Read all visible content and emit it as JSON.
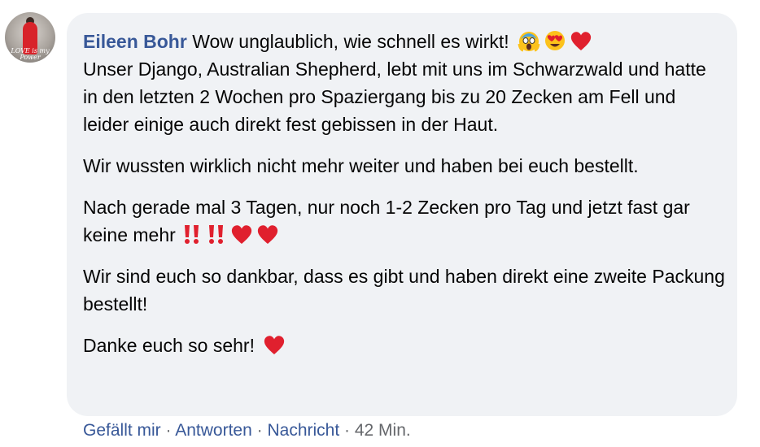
{
  "comment": {
    "author": "Eileen Bohr",
    "avatar_caption": "LOVE is my Power",
    "lines": {
      "l1_text": "Wow unglaublich, wie schnell es wirkt!",
      "p1": "Unser Django, Australian Shepherd, lebt mit uns im Schwarzwald und hatte in den letzten 2 Wochen pro Spaziergang bis zu 20 Zecken am Fell und leider einige auch direkt fest gebissen in der Haut.",
      "p2": "Wir wussten wirklich nicht mehr weiter und haben bei euch bestellt.",
      "p3": "Nach gerade mal 3 Tagen, nur noch 1-2 Zecken pro Tag und jetzt fast gar keine mehr",
      "p4": "Wir sind euch so dankbar, dass es gibt und haben direkt eine zweite Packung bestellt!",
      "p5": "Danke euch so sehr!"
    },
    "emojis": {
      "line1": [
        "face-screaming-icon",
        "heart-eyes-icon",
        "red-heart-icon"
      ],
      "p3": [
        "double-exclamation-icon",
        "double-exclamation-icon",
        "red-heart-icon",
        "red-heart-icon"
      ],
      "p5": [
        "red-heart-icon"
      ]
    }
  },
  "actions": {
    "like": "Gefällt mir",
    "reply": "Antworten",
    "message": "Nachricht",
    "separator": "·",
    "time": "42 Min."
  },
  "colors": {
    "bubble_bg": "#f0f2f5",
    "author": "#385898",
    "link": "#385898",
    "meta": "#65676b",
    "heart": "#e0202e"
  }
}
